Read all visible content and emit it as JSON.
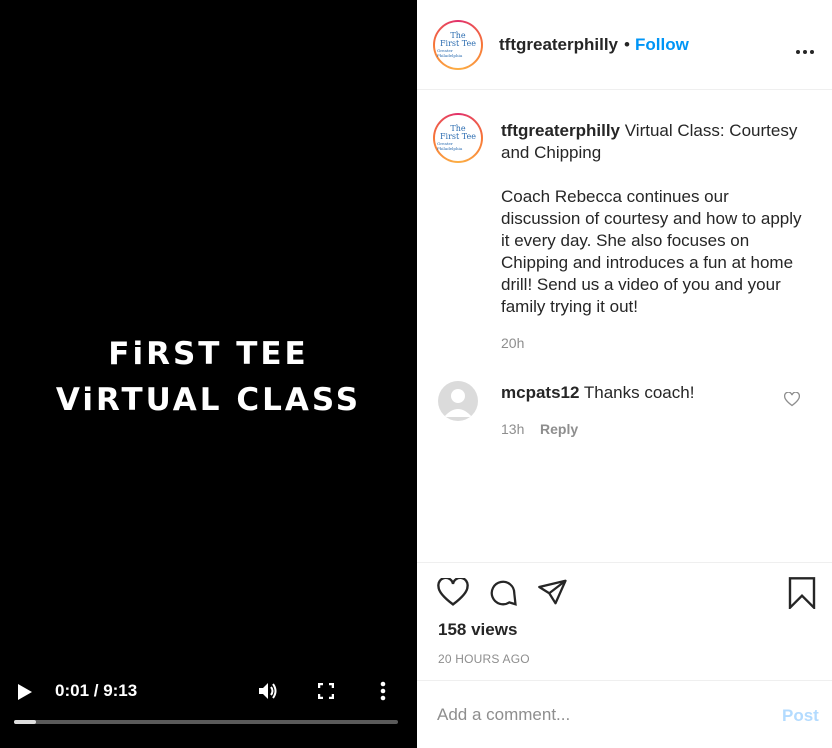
{
  "video": {
    "title_line1": "FiRST TEE",
    "title_line2": "ViRTUAL CLASS",
    "time": "0:01 / 9:13",
    "progress": 0.0018
  },
  "header": {
    "username": "tftgreaterphilly",
    "dot": "•",
    "follow_label": "Follow",
    "logo_line1": "The",
    "logo_line2": "First Tee",
    "logo_sub": "Greater Philadelphia"
  },
  "caption": {
    "username": "tftgreaterphilly",
    "headline": " Virtual Class: Courtesy and Chipping",
    "body": "Coach Rebecca continues our discussion of courtesy and how to apply it every day. She also focuses on Chipping and introduces a fun at home drill! Send us a video of you and your family trying it out!",
    "time": "20h"
  },
  "comment": {
    "username": "mcpats12",
    "text": " Thanks coach!",
    "time": "13h",
    "reply_label": "Reply"
  },
  "stats": {
    "views": "158 views",
    "ago": "20 HOURS AGO"
  },
  "add_comment": {
    "placeholder": "Add a comment...",
    "post_label": "Post"
  },
  "colors": {
    "follow": "#0095f6",
    "post_disabled": "#b3dbff",
    "muted": "#8e8e8e"
  }
}
